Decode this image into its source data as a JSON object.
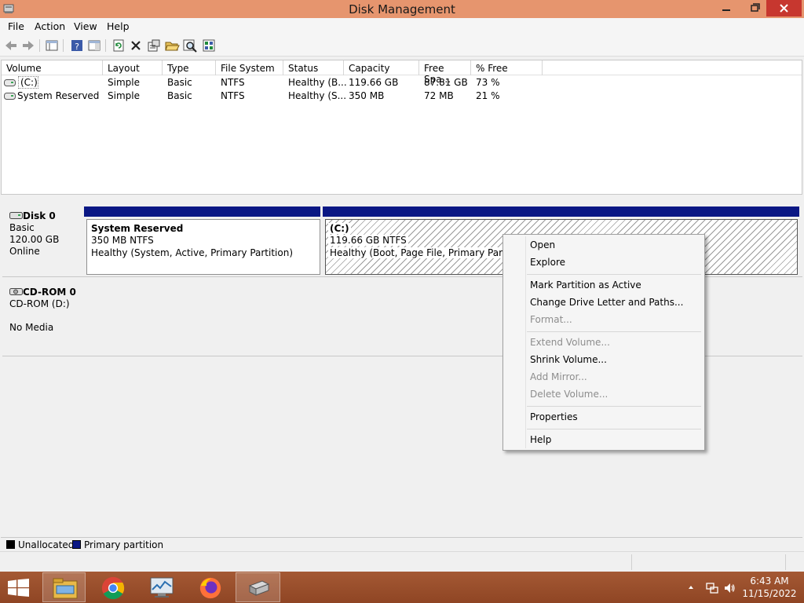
{
  "window": {
    "title": "Disk Management",
    "accent": "#e6956e",
    "close_color": "#c7372f"
  },
  "menu": [
    "File",
    "Action",
    "View",
    "Help"
  ],
  "toolbar_icons": [
    "back-arrow-icon",
    "forward-arrow-icon",
    "console-tree-icon",
    "help-icon",
    "show-hide-icon",
    "refresh-icon",
    "delete-icon",
    "properties-icon",
    "open-folder-icon",
    "find-icon",
    "rescan-disks-icon"
  ],
  "volume_list": {
    "columns": [
      "Volume",
      "Layout",
      "Type",
      "File System",
      "Status",
      "Capacity",
      "Free Spa...",
      "% Free"
    ],
    "rows": [
      [
        "(C:)",
        "Simple",
        "Basic",
        "NTFS",
        "Healthy (B...",
        "119.66 GB",
        "87.81 GB",
        "73 %"
      ],
      [
        "System Reserved",
        "Simple",
        "Basic",
        "NTFS",
        "Healthy (S...",
        "350 MB",
        "72 MB",
        "21 %"
      ]
    ]
  },
  "disks": [
    {
      "name": "Disk 0",
      "lines": [
        "Basic",
        "120.00 GB",
        "Online"
      ],
      "partitions": [
        {
          "title": "System Reserved",
          "size": "350 MB NTFS",
          "status": "Healthy (System, Active, Primary Partition)"
        },
        {
          "title": "(C:)",
          "size": "119.66 GB NTFS",
          "status": "Healthy (Boot, Page File, Primary Partition)"
        }
      ]
    },
    {
      "name": "CD-ROM 0",
      "lines": [
        "CD-ROM (D:)",
        "No Media"
      ]
    }
  ],
  "legend": [
    {
      "label": "Unallocated",
      "color": "#000000"
    },
    {
      "label": "Primary partition",
      "color": "#0a1784"
    }
  ],
  "context_menu": {
    "items": [
      {
        "label": "Open",
        "enabled": true
      },
      {
        "label": "Explore",
        "enabled": true
      },
      {
        "label": "Mark Partition as Active",
        "enabled": true
      },
      {
        "label": "Change Drive Letter and Paths...",
        "enabled": true
      },
      {
        "label": "Format...",
        "enabled": false
      },
      {
        "label": "Extend Volume...",
        "enabled": false
      },
      {
        "label": "Shrink Volume...",
        "enabled": true
      },
      {
        "label": "Add Mirror...",
        "enabled": false
      },
      {
        "label": "Delete Volume...",
        "enabled": false
      },
      {
        "label": "Properties",
        "enabled": true
      },
      {
        "label": "Help",
        "enabled": true
      }
    ]
  },
  "taskbar": {
    "apps": [
      "file-explorer-icon",
      "chrome-icon",
      "performance-monitor-icon",
      "firefox-icon",
      "disk-management-icon"
    ],
    "time": "6:43 AM",
    "date": "11/15/2022",
    "color": "#a0522d"
  }
}
